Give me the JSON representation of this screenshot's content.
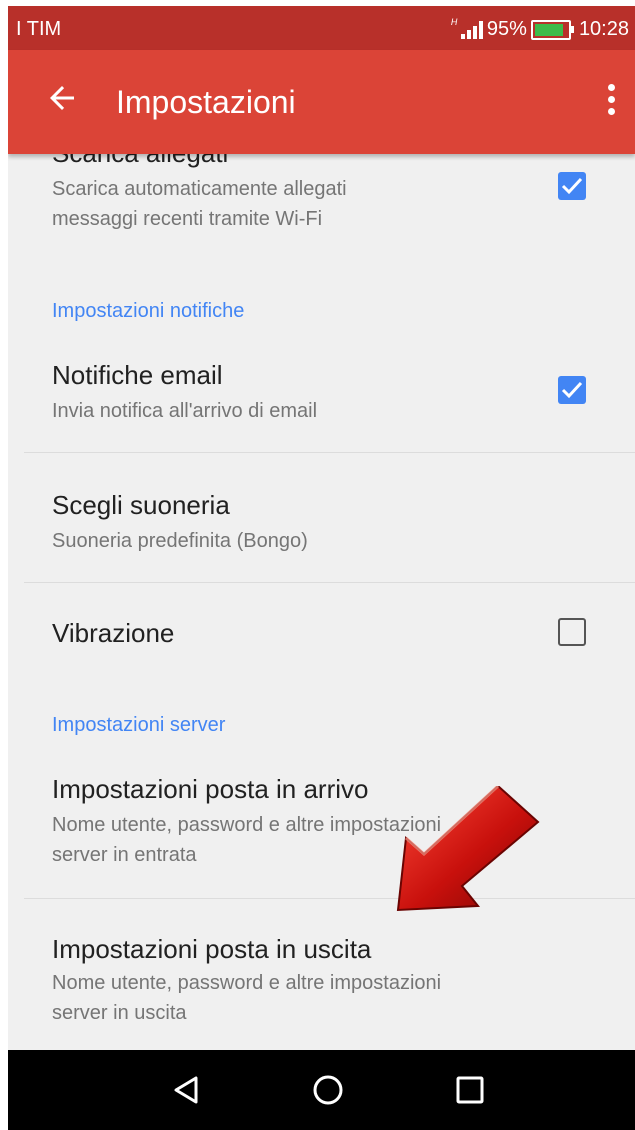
{
  "status_bar": {
    "carrier": "I TIM",
    "network": "H",
    "battery": "95%",
    "battery_level": 0.95,
    "time": "10:28"
  },
  "app_bar": {
    "title": "Impostazioni",
    "back_icon": "arrow-back-icon",
    "menu_icon": "more-vert-icon"
  },
  "settings": {
    "download": {
      "title": "Scarica allegati",
      "subtitle_1": "Scarica automaticamente allegati",
      "subtitle_2": "messaggi recenti tramite Wi-Fi",
      "checked": true
    },
    "notifications_section": "Impostazioni notifiche",
    "email_notifications": {
      "title": "Notifiche email",
      "subtitle": "Invia notifica all'arrivo di email",
      "checked": true
    },
    "ringtone": {
      "title": "Scegli suoneria",
      "subtitle": "Suoneria predefinita (Bongo)"
    },
    "vibration": {
      "title": "Vibrazione",
      "checked": false
    },
    "server_section": "Impostazioni server",
    "incoming": {
      "title": "Impostazioni posta in arrivo",
      "subtitle_1": "Nome utente, password e altre impostazioni",
      "subtitle_2": "server in entrata"
    },
    "outgoing": {
      "title": "Impostazioni posta in uscita",
      "subtitle_1": "Nome utente, password e altre impostazioni",
      "subtitle_2": "server in uscita"
    }
  },
  "nav_bar": {
    "back": "nav-back-icon",
    "home": "nav-home-icon",
    "recents": "nav-recents-icon"
  },
  "colors": {
    "status_bar": "#b8302a",
    "app_bar": "#db4437",
    "accent": "#4285f4",
    "arrow": "#c8100c"
  }
}
